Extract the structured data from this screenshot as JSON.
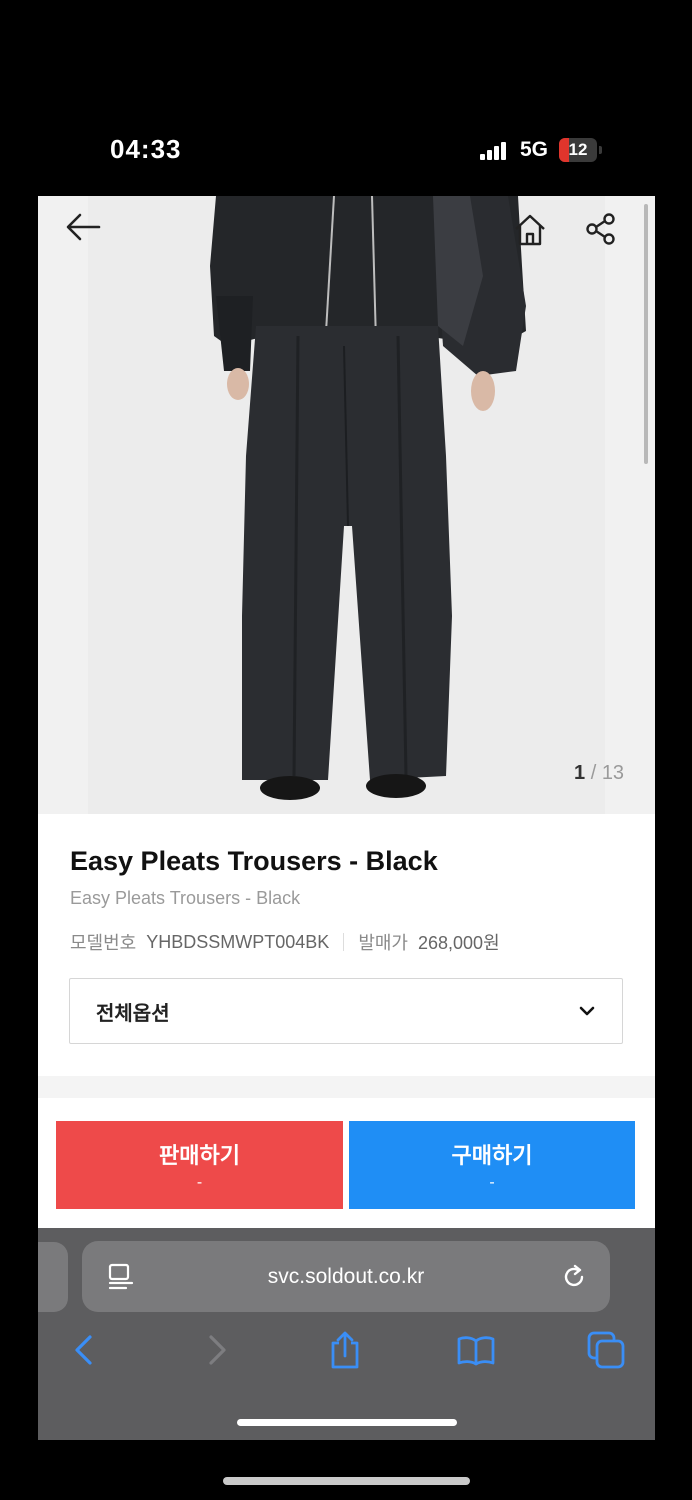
{
  "status_bar": {
    "time": "04:33",
    "network": "5G",
    "battery": "12",
    "colors": {
      "battery_low": "#e0352c"
    }
  },
  "product_page": {
    "nav": {
      "back_icon": "arrow-left-icon",
      "home_icon": "home-icon",
      "share_icon": "share-icon"
    },
    "gallery": {
      "current": "1",
      "separator": "/",
      "total": "13"
    },
    "title": "Easy Pleats Trousers - Black",
    "subtitle": "Easy Pleats Trousers - Black",
    "model_label": "모델번호",
    "model_value": "YHBDSSMWPT004BK",
    "price_label": "발매가",
    "price_value": "268,000원",
    "option_select": {
      "selected": "전체옵션",
      "icon": "chevron-down-icon"
    },
    "actions": {
      "sell_label": "판매하기",
      "sell_sub": "-",
      "buy_label": "구매하기",
      "buy_sub": "-"
    },
    "colors": {
      "sell": "#ee4a4a",
      "buy": "#1f8ef5"
    }
  },
  "browser": {
    "url": "svc.soldout.co.kr",
    "reader_icon": "reader-icon",
    "reload_icon": "reload-icon",
    "toolbar": [
      "back-icon",
      "forward-icon",
      "share-icon",
      "bookmarks-icon",
      "tabs-icon"
    ],
    "colors": {
      "toolbar_accent": "#3a8ef6"
    }
  }
}
